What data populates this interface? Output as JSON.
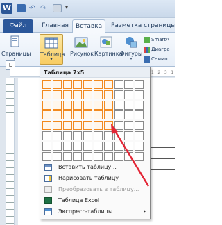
{
  "qat": {
    "logo": "W"
  },
  "tabs": [
    "Файл",
    "Главная",
    "Вставка",
    "Разметка страницы"
  ],
  "ribbon": {
    "pages": "Страницы",
    "table": "Таблица",
    "picture": "Рисунок",
    "clipart": "Картинка",
    "shapes": "Фигуры",
    "small": [
      "SmartA",
      "Диагра",
      "Снимо"
    ]
  },
  "menu": {
    "title": "Таблица 7x5",
    "rows": 8,
    "cols": 10,
    "selected_cols": 7,
    "selected_rows": 5,
    "items": [
      {
        "label": "Вставить таблицу...",
        "icon": "insert-table-icon",
        "disabled": false
      },
      {
        "label": "Нарисовать таблицу",
        "icon": "draw-table-icon",
        "disabled": false
      },
      {
        "label": "Преобразовать в таблицу...",
        "icon": "convert-table-icon",
        "disabled": true
      },
      {
        "label": "Таблица Excel",
        "icon": "excel-icon",
        "disabled": false
      },
      {
        "label": "Экспресс-таблицы",
        "icon": "quick-tables-icon",
        "disabled": false,
        "submenu": "▸"
      }
    ]
  },
  "ruler": {
    "corner": "L",
    "ticks": "· 1 · 2 · 3 · 1"
  },
  "colors": {
    "accent": "#2b579a",
    "selected_cell": "#f28a1e",
    "arrow": "#e32636"
  }
}
